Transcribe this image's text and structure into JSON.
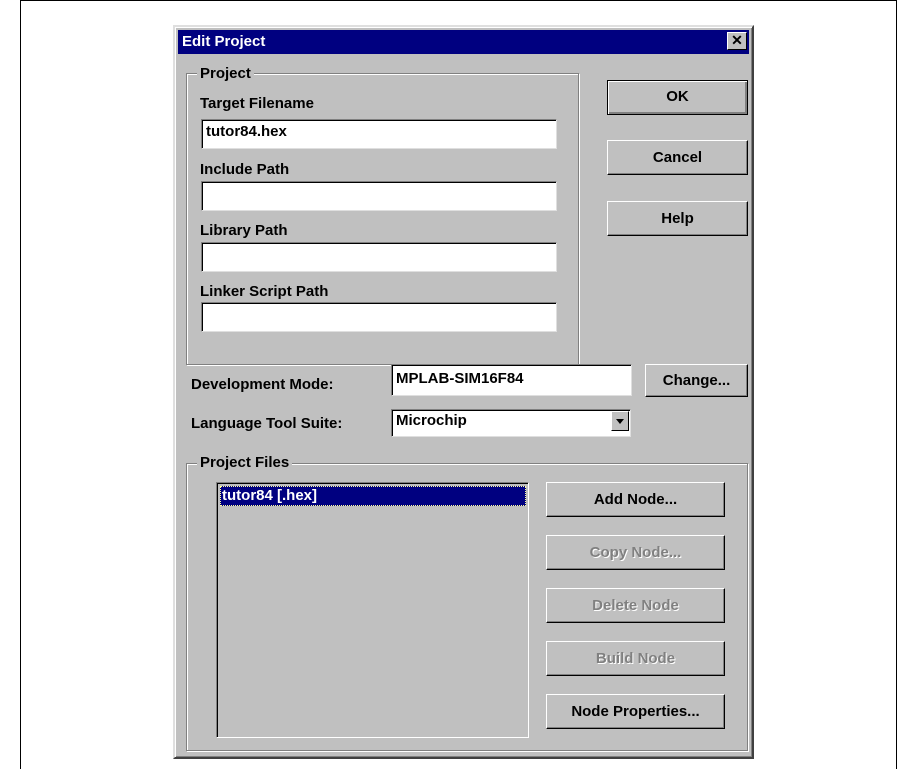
{
  "window": {
    "title": "Edit Project",
    "close_glyph": "✕"
  },
  "project_group": {
    "legend": "Project",
    "target_filename": {
      "label": "Target Filename",
      "value": "tutor84.hex"
    },
    "include_path": {
      "label": "Include Path",
      "value": ""
    },
    "library_path": {
      "label": "Library Path",
      "value": ""
    },
    "linker_script_path": {
      "label": "Linker Script Path",
      "value": ""
    }
  },
  "buttons": {
    "ok": "OK",
    "cancel": "Cancel",
    "help": "Help",
    "change": "Change..."
  },
  "development_mode": {
    "label": "Development Mode:",
    "value": "MPLAB-SIM16F84"
  },
  "language_tool_suite": {
    "label": "Language Tool Suite:",
    "value": "Microchip"
  },
  "project_files": {
    "legend": "Project Files",
    "items": [
      {
        "label": "tutor84 [.hex]",
        "selected": true
      }
    ],
    "buttons": {
      "add_node": "Add Node...",
      "copy_node": "Copy Node...",
      "delete_node": "Delete Node",
      "build_node": "Build Node",
      "node_properties": "Node Properties..."
    }
  },
  "colors": {
    "titlebar": "#000080",
    "face": "#c0c0c0",
    "selection": "#000080"
  }
}
